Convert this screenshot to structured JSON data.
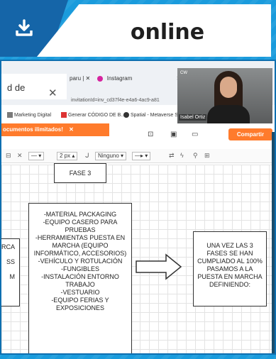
{
  "header": {
    "title": "online",
    "download_icon": "download-tray-icon"
  },
  "browser": {
    "active_tab_title": "d de",
    "active_tab_close": "✕",
    "tab_strip": "paru | ✕",
    "instagram_tab": "Instagram",
    "tab_close": "✕",
    "url": "invitationId=inv_cd37f4e-e4a6-4ac9-a81",
    "bookmarks": [
      {
        "label": "Marketing Digital",
        "icon": "doc-icon",
        "color": "#7a7a7a"
      },
      {
        "label": "Generar CÓDIGO DE B...",
        "icon": "red-square-icon",
        "color": "#d33"
      },
      {
        "label": "Spatial - Metaverse S",
        "icon": "spatial-icon",
        "color": "#333"
      }
    ],
    "banner_text": "ocumentos ilimitados!",
    "banner_close": "✕"
  },
  "app_toolbar": {
    "share_label": "Compartir"
  },
  "format_bar": {
    "stroke_size": "2 px",
    "arrow_start": "Ninguno",
    "arrow_end": "—▸"
  },
  "video": {
    "name": "Isabel Ortiz",
    "tag": "CW"
  },
  "diagram": {
    "phase_label": "FASE 3",
    "left_box_lines": [
      "RCA",
      "",
      "SS",
      "",
      "M"
    ],
    "middle_box_lines": [
      "-MATERIAL PACKAGING",
      "-EQUIPO CASERO PARA",
      "PRUEBAS",
      "-HERRAMIENTAS PUESTA EN",
      "MARCHA (EQUIPO",
      "INFORMÁTICO, ACCESORIOS)",
      "-VEHÍCULO Y ROTULACIÓN",
      "-FUNGIBLES",
      "-INSTALACIÓN ENTORNO",
      "TRABAJO",
      "-VESTUARIO",
      "-EQUIPO FERIAS Y",
      "EXPOSICIONES"
    ],
    "right_box_lines": [
      "UNA VEZ LAS 3",
      "FASES SE HAN",
      "CUMPLIADO AL 100%",
      "PASAMOS A LA",
      "PUESTA EN MARCHA",
      "DEFINIENDO:"
    ]
  }
}
